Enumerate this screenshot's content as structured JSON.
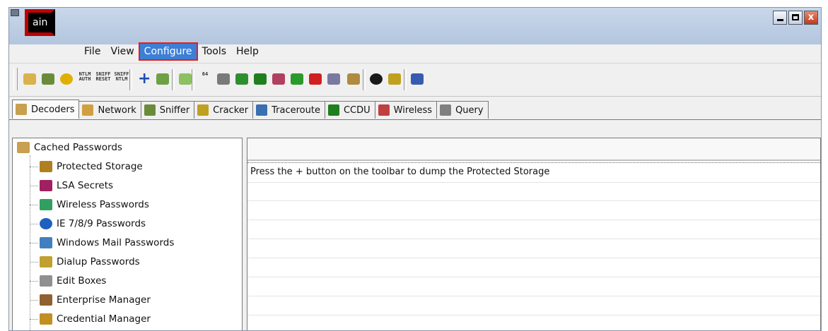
{
  "app": {
    "logo_text": "ain"
  },
  "window_controls": {
    "close_glyph": "x"
  },
  "menu": {
    "items": [
      "File",
      "View",
      "Configure",
      "Tools",
      "Help"
    ],
    "active": "Configure"
  },
  "toolbar": {
    "buttons": [
      {
        "icon": "open-folder-icon",
        "color": "#d8b24a"
      },
      {
        "icon": "sniffer-start-icon",
        "color": "#6a8c3a"
      },
      {
        "icon": "radioactive-icon",
        "color": "#e0b000"
      },
      {
        "icon": "ntlm-auth-icon",
        "text": "NTLM AUTH"
      },
      {
        "icon": "sniff-reset-icon",
        "text": "SNIFF RESET"
      },
      {
        "icon": "sniff-ntlm-icon",
        "text": "SNIFF NTLM"
      },
      {
        "icon": "add-icon",
        "color": "#1b4db3"
      },
      {
        "icon": "remove-icon",
        "color": "#6ea046"
      },
      {
        "icon": "export-icon",
        "color": "#8cc060"
      },
      {
        "icon": "base64-icon",
        "text": "64"
      },
      {
        "icon": "test-password-icon",
        "color": "#7a7a7a"
      },
      {
        "icon": "hash-table-icon",
        "color": "#2f8f2f"
      },
      {
        "icon": "md5-table-icon",
        "color": "#1f7f1f"
      },
      {
        "icon": "chart-icon",
        "color": "#b04060"
      },
      {
        "icon": "green-box-icon",
        "color": "#2a9a2a"
      },
      {
        "icon": "red-box-icon",
        "color": "#d02020"
      },
      {
        "icon": "network-map-icon",
        "color": "#7a7aa0"
      },
      {
        "icon": "certificate-icon",
        "color": "#b08a40"
      },
      {
        "icon": "info-icon",
        "color": "#1a1a1a"
      },
      {
        "icon": "help-icon",
        "color": "#c0a020"
      },
      {
        "icon": "exit-icon",
        "color": "#3a5ab0"
      }
    ]
  },
  "tabs": [
    {
      "label": "Decoders",
      "icon": "decoders-icon",
      "color": "#c8a050",
      "active": true
    },
    {
      "label": "Network",
      "icon": "network-icon",
      "color": "#d0a040"
    },
    {
      "label": "Sniffer",
      "icon": "sniffer-icon",
      "color": "#6a8c3a"
    },
    {
      "label": "Cracker",
      "icon": "cracker-icon",
      "color": "#c0a020"
    },
    {
      "label": "Traceroute",
      "icon": "traceroute-icon",
      "color": "#3a6fb0"
    },
    {
      "label": "CCDU",
      "icon": "ccdu-icon",
      "color": "#1f7f1f"
    },
    {
      "label": "Wireless",
      "icon": "wireless-icon",
      "color": "#c04040"
    },
    {
      "label": "Query",
      "icon": "query-icon",
      "color": "#808080"
    }
  ],
  "tree": {
    "root": {
      "label": "Cached Passwords",
      "icon": "cached-passwords-icon",
      "color": "#c8a050"
    },
    "items": [
      {
        "label": "Protected Storage",
        "icon": "protected-storage-icon",
        "color": "#b08020"
      },
      {
        "label": "LSA Secrets",
        "icon": "lsa-secrets-icon",
        "color": "#a02060"
      },
      {
        "label": "Wireless Passwords",
        "icon": "wireless-passwords-icon",
        "color": "#30a060"
      },
      {
        "label": "IE 7/8/9 Passwords",
        "icon": "internet-explorer-icon",
        "color": "#1e5fc0"
      },
      {
        "label": "Windows Mail Passwords",
        "icon": "windows-mail-icon",
        "color": "#4080c0"
      },
      {
        "label": "Dialup Passwords",
        "icon": "dialup-icon",
        "color": "#c0a030"
      },
      {
        "label": "Edit Boxes",
        "icon": "edit-boxes-icon",
        "color": "#909090"
      },
      {
        "label": "Enterprise Manager",
        "icon": "enterprise-manager-icon",
        "color": "#906030"
      },
      {
        "label": "Credential Manager",
        "icon": "credential-manager-icon",
        "color": "#c09020"
      }
    ]
  },
  "listview": {
    "message": "Press the + button on the toolbar to dump the Protected Storage"
  }
}
